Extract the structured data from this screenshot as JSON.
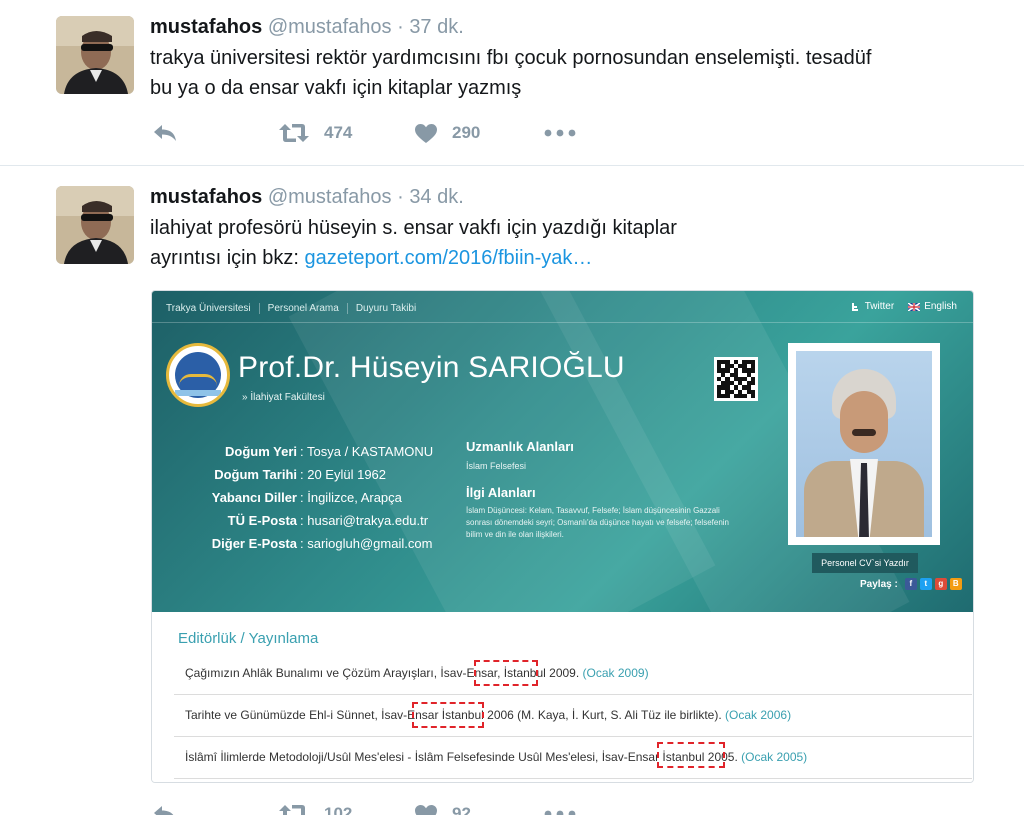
{
  "tweets": [
    {
      "name": "mustafahos",
      "handle": "@mustafahos",
      "separator": "·",
      "time": "37 dk.",
      "text_line1": "trakya üniversitesi rektör yardımcısını fbı çocuk pornosundan enselemişti. tesadüf",
      "text_line2": "bu ya o da ensar vakfı için kitaplar yazmış",
      "retweets": "474",
      "likes": "290"
    },
    {
      "name": "mustafahos",
      "handle": "@mustafahos",
      "separator": "·",
      "time": "34 dk.",
      "text_line1": "ilahiyat profesörü hüseyin s. ensar vakfı için yazdığı kitaplar",
      "text_line2_prefix": "ayrıntısı için bkz:",
      "link": "gazeteport.com/2016/fbiin-yak…",
      "retweets": "102",
      "likes": "92"
    }
  ],
  "icons": {
    "reply": "reply-icon",
    "retweet": "retweet-icon",
    "like": "heart-icon",
    "more": "more-dots-icon"
  },
  "colors": {
    "link": "#1b95e0",
    "muted": "#8899a6",
    "banner": "#2f8a8a",
    "highlight": "#e0242a"
  },
  "embedded": {
    "nav": [
      "Trakya Üniversitesi",
      "Personel Arama",
      "Duyuru Takibi"
    ],
    "twitter": "Twitter",
    "english": "English",
    "prof_name": "Prof.Dr. Hüseyin SARIOĞLU",
    "faculty": "» İlahiyat Fakültesi",
    "info": [
      {
        "label": "Doğum Yeri",
        "value": "Tosya / KASTAMONU"
      },
      {
        "label": "Doğum Tarihi",
        "value": "20 Eylül 1962"
      },
      {
        "label": "Yabancı Diller",
        "value": "İngilizce, Arapça"
      },
      {
        "label": "TÜ E-Posta",
        "value": "husari@trakya.edu.tr"
      },
      {
        "label": "Diğer E-Posta",
        "value": "sariogluh@gmail.com"
      }
    ],
    "uzmanlik_title": "Uzmanlık Alanları",
    "uzmanlik_text": "İslam Felsefesi",
    "ilgi_title": "İlgi Alanları",
    "ilgi_text": "İslam Düşüncesi: Kelam, Tasavvuf, Felsefe; İslam düşüncesinin Gazzali sonrası dönemdeki seyri; Osmanlı'da düşünce hayatı ve felsefe; felsefenin bilim ve din ile olan ilişkileri.",
    "cv_button": "Personel CV`si Yazdır",
    "share_label": "Paylaş :",
    "pubs_title": "Editörlük / Yayınlama",
    "pubs": [
      {
        "text": "Çağımızın Ahlâk Bunalımı ve Çözüm Arayışları, İsav-Ensar, İstanbul 2009.",
        "date": "(Ocak 2009)"
      },
      {
        "text": "Tarihte ve Günümüzde Ehl-i Sünnet, İsav-Ensar İstanbul 2006 (M. Kaya, İ. Kurt, S. Ali Tüz ile birlikte).",
        "date": "(Ocak 2006)"
      },
      {
        "text": "İslâmî İlimlerde Metodoloji/Usûl Mes'elesi - İslâm Felsefesinde Usûl Mes'elesi, İsav-Ensar İstanbul 2005.",
        "date": "(Ocak 2005)"
      }
    ]
  }
}
